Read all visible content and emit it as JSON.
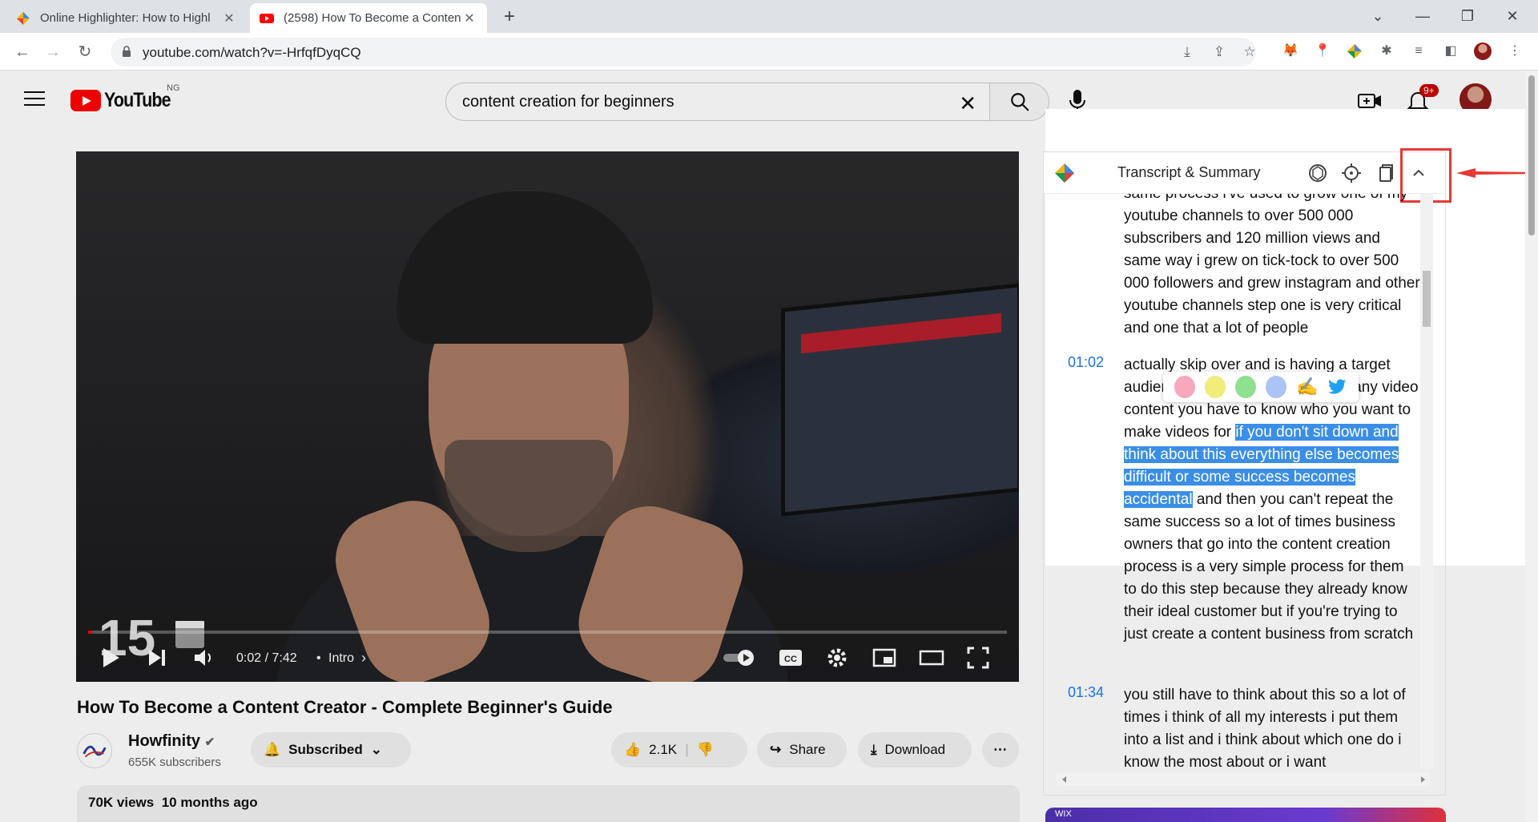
{
  "browser": {
    "tabs": [
      {
        "title": "Online Highlighter: How to Highl",
        "close": "✕"
      },
      {
        "title": "(2598) How To Become a Content",
        "close": "✕"
      }
    ],
    "new_tab": "+",
    "url": "youtube.com/watch?v=-HrfqfDyqCQ",
    "window_controls": {
      "minimize": "—",
      "maximize": "❐",
      "close": "✕",
      "tablist": "⌄"
    }
  },
  "youtube": {
    "logo_text": "YouTube",
    "country_code": "NG",
    "search_query": "content creation for beginners",
    "notifications_badge": "9+",
    "player": {
      "time": "0:02 / 7:42",
      "chapter": "Intro",
      "overlay_number": "15",
      "progress_fraction": 0.004
    },
    "video_title": "How To Become a Content Creator - Complete Beginner's Guide",
    "channel": {
      "name": "Howfinity",
      "subscribers": "655K subscribers",
      "subscribe_label": "Subscribed"
    },
    "actions": {
      "likes": "2.1K",
      "share": "Share",
      "download": "Download"
    },
    "description": {
      "views": "70K views",
      "age": "10 months ago"
    }
  },
  "transcript": {
    "title": "Transcript & Summary",
    "segments": [
      {
        "time": "",
        "text_parts": [
          {
            "t": "same process i've used to grow one of my youtube channels to over 500 000 subscribers and 120 million views and same way i grew on tick-tock to over 500 000 followers and grew instagram and other youtube channels step one is very critical and one that a lot of people",
            "hl": false
          }
        ]
      },
      {
        "time": "01:02",
        "text_parts": [
          {
            "t": "actually skip over and is having a target audience before you start making any video content you have to know who you want to make videos for ",
            "hl": false
          },
          {
            "t": "if you don't sit down and think about this everything else becomes difficult or some success becomes accidental",
            "hl": true
          },
          {
            "t": " and then you can't repeat the same success so a lot of times business owners that go into the content creation process is a very simple process for them to do this step because they already know their ideal customer but if you're trying to just create a content business from scratch",
            "hl": false
          }
        ]
      },
      {
        "time": "01:34",
        "text_parts": [
          {
            "t": "you still have to think about this so a lot of times i think of all my interests i put them into a list and i think about which one do i know the most about or i want",
            "hl": false
          }
        ]
      }
    ],
    "highlight_colors": [
      "#f7a8bd",
      "#f2ec7a",
      "#8fe08f",
      "#a9c4f5"
    ]
  },
  "ad": {
    "text": "WIX"
  },
  "colors": {
    "accent": "#1a73e8",
    "youtube_red": "#ff0000",
    "annotation_red": "#e53935",
    "highlight": "#3a8ee6"
  }
}
